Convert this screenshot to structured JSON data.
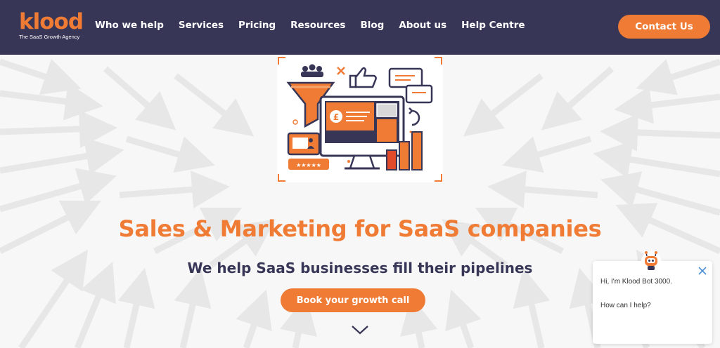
{
  "brand": {
    "name": "klood",
    "tagline": "The SaaS Growth Agency",
    "accent": "#ef7b35",
    "navy": "#383657"
  },
  "nav": {
    "items": [
      {
        "label": "Who we help"
      },
      {
        "label": "Services"
      },
      {
        "label": "Pricing"
      },
      {
        "label": "Resources"
      },
      {
        "label": "Blog"
      },
      {
        "label": "About us"
      },
      {
        "label": "Help Centre"
      }
    ],
    "cta_label": "Contact Us"
  },
  "hero": {
    "headline": "Sales & Marketing for SaaS companies",
    "subhead": "We help SaaS businesses fill their pipelines",
    "cta_label": "Book your growth call",
    "illustration_icon": "sales-funnel-dashboard-illustration",
    "scroll_icon": "chevron-down-icon",
    "currency_symbol": "£",
    "rating_stars": "★★★★★"
  },
  "chat": {
    "greeting": "Hi, I'm Klood Bot 3000.",
    "prompt": "How can I help?",
    "close_icon": "close-icon",
    "avatar_icon": "robot-avatar-icon"
  }
}
